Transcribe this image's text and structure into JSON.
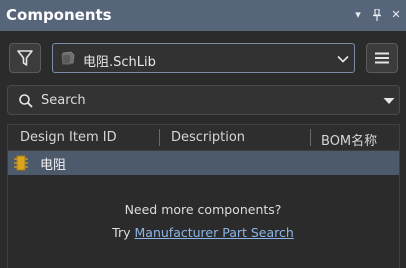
{
  "panel": {
    "title": "Components",
    "controls": {
      "menu": "▾",
      "pin": "pin-icon",
      "close": "✕"
    }
  },
  "toolbar": {
    "filter_icon": "filter-icon",
    "library_selected": "电阻.SchLib",
    "library_icon": "schlib-icon",
    "menu_icon": "hamburger-menu-icon"
  },
  "search": {
    "placeholder": "Search",
    "icon": "search-icon"
  },
  "grid": {
    "columns": [
      "Design Item ID",
      "Description",
      "BOM名称"
    ],
    "rows": [
      {
        "design_item_id": "电阻",
        "description": "",
        "bom_name": "",
        "icon": "component-icon",
        "selected": true
      }
    ]
  },
  "empty_hint": {
    "line1": "Need more components?",
    "try_prefix": "Try",
    "link_text": "Manufacturer Part Search"
  },
  "colors": {
    "titlebar": "#566579",
    "background": "#2b2b2b",
    "selected_row": "#4d5a6c",
    "link": "#8cb4e6",
    "combo_border": "#7b8da6"
  }
}
